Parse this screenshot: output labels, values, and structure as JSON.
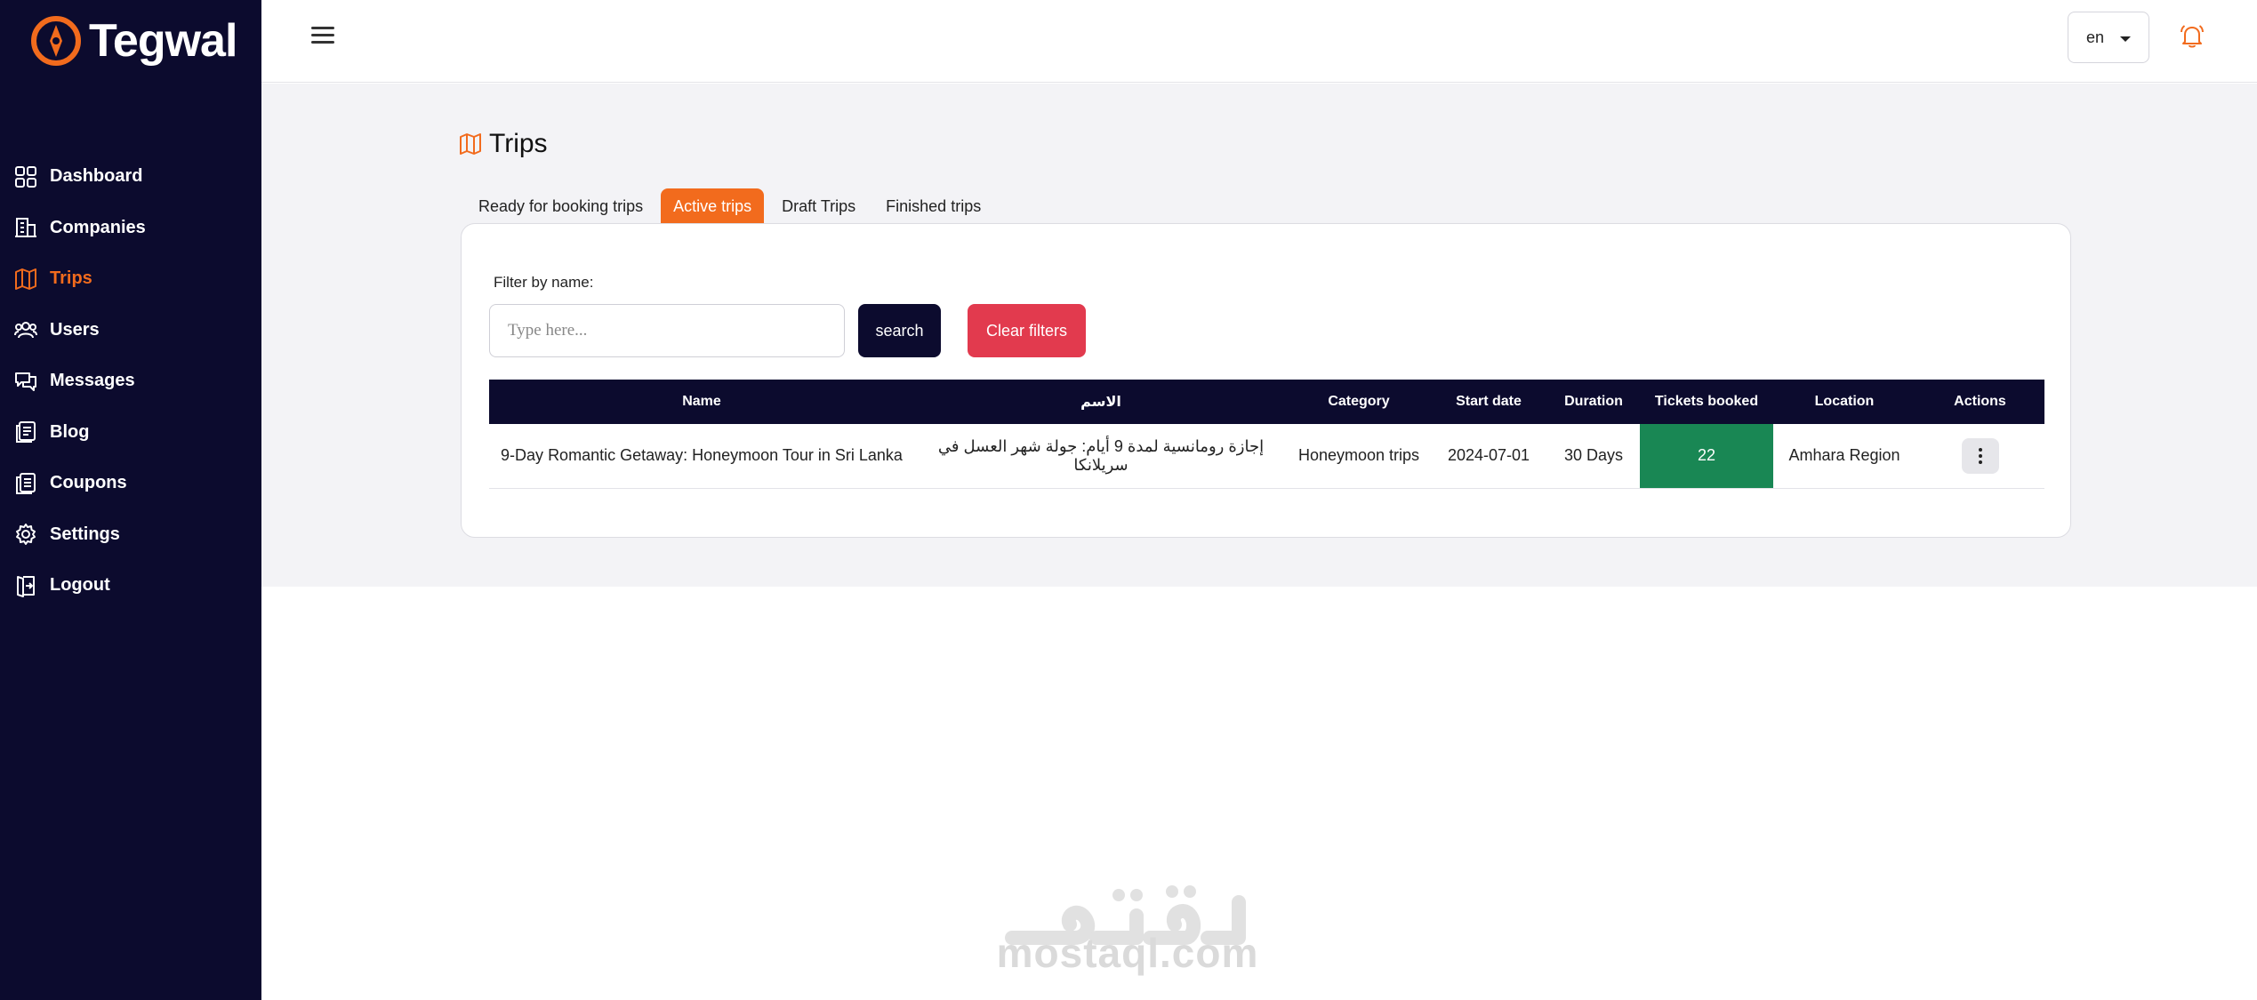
{
  "brand": {
    "name": "Tegwal",
    "accent": "#f26b1d",
    "sidebar_bg": "#0c0b2e"
  },
  "sidebar": {
    "items": [
      {
        "label": "Dashboard",
        "icon": "grid-icon"
      },
      {
        "label": "Companies",
        "icon": "building-icon"
      },
      {
        "label": "Trips",
        "icon": "map-icon",
        "active": true
      },
      {
        "label": "Users",
        "icon": "users-icon"
      },
      {
        "label": "Messages",
        "icon": "chat-icon"
      },
      {
        "label": "Blog",
        "icon": "blog-icon"
      },
      {
        "label": "Coupons",
        "icon": "coupon-icon"
      },
      {
        "label": "Settings",
        "icon": "gear-icon"
      },
      {
        "label": "Logout",
        "icon": "logout-icon"
      }
    ]
  },
  "topbar": {
    "language": "en"
  },
  "page": {
    "title": "Trips",
    "tabs": [
      {
        "label": "Ready for booking trips"
      },
      {
        "label": "Active trips",
        "active": true
      },
      {
        "label": "Draft Trips"
      },
      {
        "label": "Finished trips"
      }
    ]
  },
  "filters": {
    "label": "Filter by name:",
    "placeholder": "Type here...",
    "search_label": "search",
    "clear_label": "Clear filters"
  },
  "table": {
    "columns": [
      "Name",
      "الاسم",
      "Category",
      "Start date",
      "Duration",
      "Tickets booked",
      "Location",
      "Actions"
    ],
    "rows": [
      {
        "name": "9-Day Romantic Getaway: Honeymoon Tour in Sri Lanka",
        "name_ar": "إجازة رومانسية لمدة 9 أيام: جولة شهر العسل في سريلانكا",
        "category": "Honeymoon trips",
        "start_date": "2024-07-01",
        "duration": "30 Days",
        "tickets_booked": "22",
        "location": "Amhara Region"
      }
    ]
  },
  "watermark": {
    "text": "mostaql.com"
  }
}
